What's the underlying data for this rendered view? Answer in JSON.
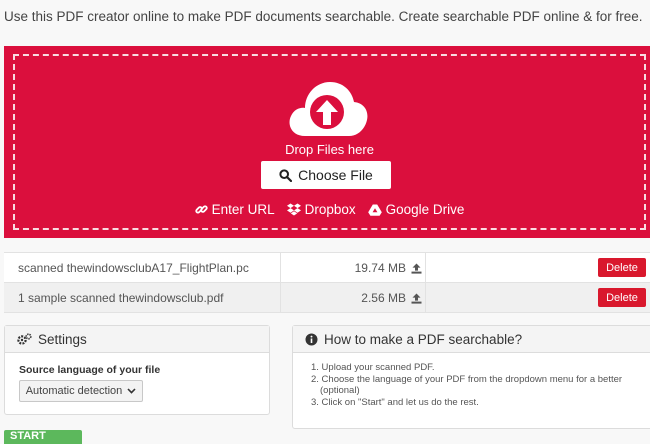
{
  "intro": "Use this PDF creator online to make PDF documents searchable. Create searchable PDF online & for free.",
  "upload": {
    "drop_label": "Drop Files here",
    "choose_label": "Choose File",
    "sources": [
      {
        "label": "Enter URL",
        "icon": "link-icon"
      },
      {
        "label": "Dropbox",
        "icon": "dropbox-icon"
      },
      {
        "label": "Google Drive",
        "icon": "google-drive-icon"
      }
    ],
    "accent": "#db0f3d"
  },
  "files": [
    {
      "name": "scanned thewindowsclubA17_FlightPlan.pc",
      "size": "19.74 MB",
      "action": "Delete"
    },
    {
      "name": "1 sample scanned thewindowsclub.pdf",
      "size": "2.56 MB",
      "action": "Delete"
    }
  ],
  "settings": {
    "title": "Settings",
    "source_language_label": "Source language of your file",
    "source_language_value": "Automatic detection"
  },
  "howto": {
    "title": "How to make a PDF searchable?",
    "steps": [
      "1. Upload your scanned PDF.",
      "2. Choose the language of your PDF from the dropdown menu for a better",
      "(optional)",
      "3. Click on \"Start\" and let us do the rest."
    ]
  },
  "start_label": "START"
}
